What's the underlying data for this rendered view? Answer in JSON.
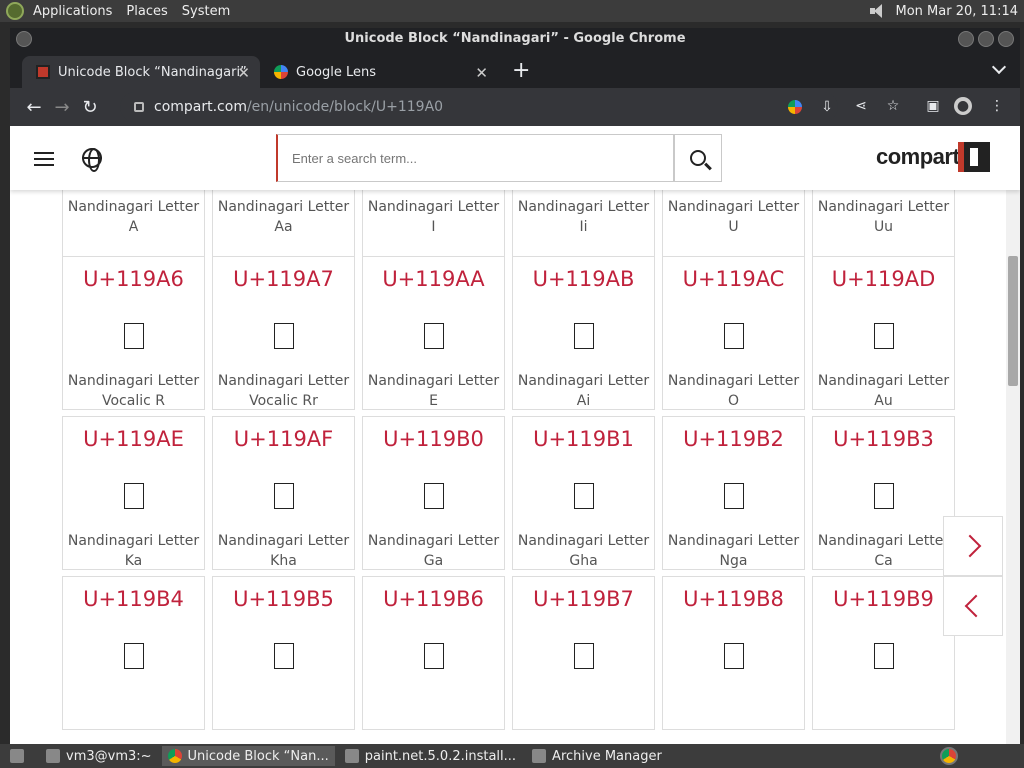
{
  "system": {
    "menus": [
      "Applications",
      "Places",
      "System"
    ],
    "datetime": "Mon Mar 20, 11:14"
  },
  "window": {
    "title": "Unicode Block “Nandinagari” - Google Chrome"
  },
  "tabs": [
    {
      "label": "Unicode Block “Nandinagari”",
      "active": true
    },
    {
      "label": "Google Lens",
      "active": false
    }
  ],
  "address": {
    "host": "compart.com",
    "path": "/en/unicode/block/U+119A0"
  },
  "site": {
    "search_placeholder": "Enter a search term...",
    "logo_text": "compart"
  },
  "rows": [
    {
      "cells": [
        {
          "code": "",
          "name1": "Nandinagari Letter",
          "name2": "A"
        },
        {
          "code": "",
          "name1": "Nandinagari Letter",
          "name2": "Aa"
        },
        {
          "code": "",
          "name1": "Nandinagari Letter",
          "name2": "I"
        },
        {
          "code": "",
          "name1": "Nandinagari Letter",
          "name2": "Ii"
        },
        {
          "code": "",
          "name1": "Nandinagari Letter",
          "name2": "U"
        },
        {
          "code": "",
          "name1": "Nandinagari Letter",
          "name2": "Uu"
        }
      ]
    },
    {
      "cells": [
        {
          "code": "U+119A6",
          "name1": "Nandinagari Letter",
          "name2": "Vocalic R"
        },
        {
          "code": "U+119A7",
          "name1": "Nandinagari Letter",
          "name2": "Vocalic Rr"
        },
        {
          "code": "U+119AA",
          "name1": "Nandinagari Letter",
          "name2": "E"
        },
        {
          "code": "U+119AB",
          "name1": "Nandinagari Letter",
          "name2": "Ai"
        },
        {
          "code": "U+119AC",
          "name1": "Nandinagari Letter",
          "name2": "O"
        },
        {
          "code": "U+119AD",
          "name1": "Nandinagari Letter",
          "name2": "Au"
        }
      ]
    },
    {
      "cells": [
        {
          "code": "U+119AE",
          "name1": "Nandinagari Letter",
          "name2": "Ka"
        },
        {
          "code": "U+119AF",
          "name1": "Nandinagari Letter",
          "name2": "Kha"
        },
        {
          "code": "U+119B0",
          "name1": "Nandinagari Letter",
          "name2": "Ga"
        },
        {
          "code": "U+119B1",
          "name1": "Nandinagari Letter",
          "name2": "Gha"
        },
        {
          "code": "U+119B2",
          "name1": "Nandinagari Letter",
          "name2": "Nga"
        },
        {
          "code": "U+119B3",
          "name1": "Nandinagari Letter",
          "name2": "Ca"
        }
      ]
    },
    {
      "cells": [
        {
          "code": "U+119B4",
          "name1": "",
          "name2": ""
        },
        {
          "code": "U+119B5",
          "name1": "",
          "name2": ""
        },
        {
          "code": "U+119B6",
          "name1": "",
          "name2": ""
        },
        {
          "code": "U+119B7",
          "name1": "",
          "name2": ""
        },
        {
          "code": "U+119B8",
          "name1": "",
          "name2": ""
        },
        {
          "code": "U+119B9",
          "name1": "",
          "name2": ""
        }
      ]
    }
  ],
  "taskbar": [
    {
      "label": "vm3@vm3:~",
      "active": false
    },
    {
      "label": "Unicode Block “Nan...",
      "active": true
    },
    {
      "label": "paint.net.5.0.2.install...",
      "active": false
    },
    {
      "label": "Archive Manager",
      "active": false
    }
  ],
  "colors": {
    "accent": "#c0223c"
  }
}
